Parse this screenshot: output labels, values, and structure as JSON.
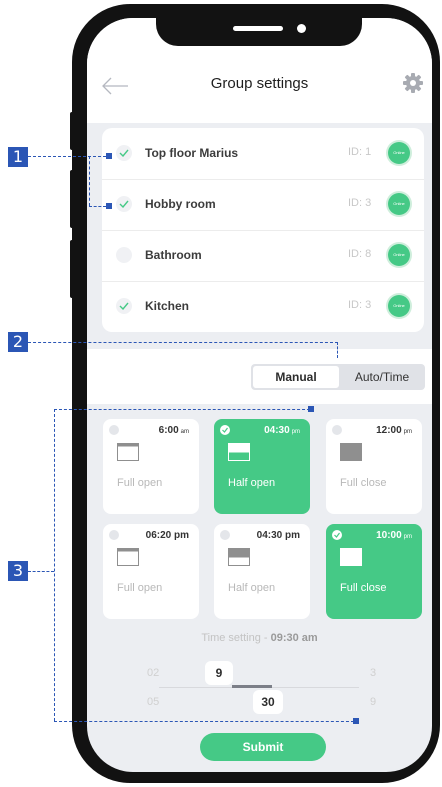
{
  "header": {
    "title": "Group settings",
    "back_icon": "back-arrow-icon",
    "settings_icon": "gear-icon"
  },
  "rooms": [
    {
      "name": "Top floor Marius",
      "id": "ID: 1",
      "checked": true,
      "status": "Online"
    },
    {
      "name": "Hobby room",
      "id": "ID: 3",
      "checked": true,
      "status": "Online"
    },
    {
      "name": "Bathroom",
      "id": "ID: 8",
      "checked": false,
      "status": "Online"
    },
    {
      "name": "Kitchen",
      "id": "ID: 3",
      "checked": true,
      "status": "Online"
    }
  ],
  "mode_toggle": {
    "manual": "Manual",
    "auto": "Auto/Time",
    "active": "Manual"
  },
  "tiles": [
    {
      "time": "6:00",
      "ampm": "am",
      "label": "Full open",
      "selected": false
    },
    {
      "time": "04:30",
      "ampm": "pm",
      "label": "Half open",
      "selected": true
    },
    {
      "time": "12:00",
      "ampm": "pm",
      "label": "Full close",
      "selected": false
    },
    {
      "time": "06:20 pm",
      "ampm": "",
      "label": "Full open",
      "selected": false
    },
    {
      "time": "04:30 pm",
      "ampm": "",
      "label": "Half open",
      "selected": false
    },
    {
      "time": "10:00",
      "ampm": "pm",
      "label": "Full close",
      "selected": true
    }
  ],
  "time_setting": {
    "label": "Time setting - ",
    "value": "09:30 am",
    "hours": {
      "prev": "02",
      "selected": "9",
      "next": "3"
    },
    "minutes": {
      "prev": "05",
      "selected": "30",
      "next": "9"
    }
  },
  "submit_label": "Submit",
  "annotations": {
    "a1": "1",
    "a2": "2",
    "a3": "3"
  },
  "colors": {
    "accent": "#45c986",
    "annotation": "#2b56b5"
  }
}
